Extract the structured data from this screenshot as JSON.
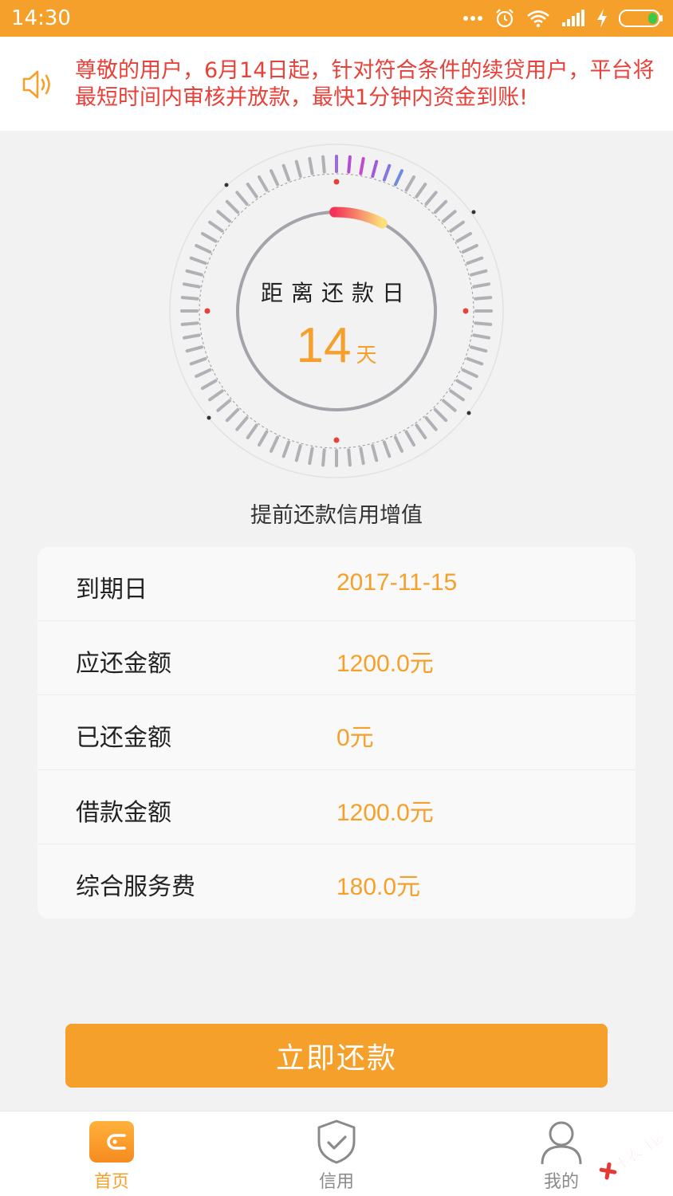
{
  "status_bar": {
    "time": "14:30",
    "icons": [
      "more-icon",
      "alarm-icon",
      "wifi-icon",
      "signal-icon",
      "charging-icon",
      "battery-icon"
    ]
  },
  "notice": {
    "icon": "speaker-icon",
    "text": "尊敬的用户，6月14日起，针对符合条件的续贷用户，平台将最短时间内审核并放款，最快1分钟内资金到账!"
  },
  "countdown": {
    "title": "距离还款日",
    "days": "14",
    "unit": "天"
  },
  "subtitle": "提前还款信用增值",
  "loan_details": [
    {
      "label": "到期日",
      "value": "2017-11-15"
    },
    {
      "label": "应还金额",
      "value": "1200.0元"
    },
    {
      "label": "已还金额",
      "value": "0元"
    },
    {
      "label": "借款金额",
      "value": "1200.0元"
    },
    {
      "label": "综合服务费",
      "value": "180.0元"
    }
  ],
  "repay_button": {
    "label": "立即还款"
  },
  "tabs": [
    {
      "label": "首页",
      "icon": "wallet-icon",
      "active": true
    },
    {
      "label": "信用",
      "icon": "shield-check-icon",
      "active": false
    },
    {
      "label": "我的",
      "icon": "person-icon",
      "active": false
    }
  ],
  "watermark": {
    "text": "卡农社区"
  },
  "colors": {
    "accent": "#f5a02a",
    "notice_text": "#e8413a",
    "inactive_tab": "#8a8a8a"
  }
}
